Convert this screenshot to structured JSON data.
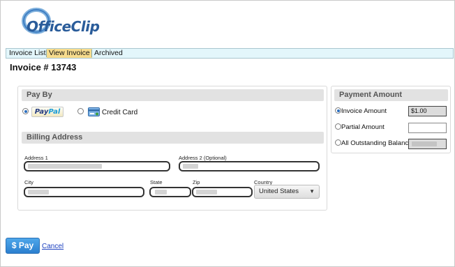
{
  "brand": {
    "logo_text": "OfficeClip",
    "logo_color": "#2a5c9a"
  },
  "tabs": [
    {
      "label": "Invoice List",
      "active": false
    },
    {
      "label": "View Invoice",
      "active": true
    },
    {
      "label": "Archived",
      "active": false
    }
  ],
  "page_title": "Invoice # 13743",
  "pay_by": {
    "heading": "Pay By",
    "options": [
      {
        "label": "PayPal",
        "selected": true,
        "icon": "paypal-logo"
      },
      {
        "label": "Credit Card",
        "selected": false,
        "icon": "credit-card-icon"
      }
    ]
  },
  "billing": {
    "heading": "Billing Address",
    "address1_label": "Address 1",
    "address2_label": "Address 2 (Optional)",
    "city_label": "City",
    "state_label": "State",
    "zip_label": "Zip",
    "country_label": "Country",
    "country_value": "United States"
  },
  "payment_amount": {
    "heading": "Payment Amount",
    "options": [
      {
        "label": "Invoice Amount",
        "selected": true,
        "value": "$1.00"
      },
      {
        "label": "Partial Amount",
        "selected": false,
        "value": ""
      },
      {
        "label": "All Outstanding Balance",
        "selected": false,
        "value": ""
      }
    ]
  },
  "actions": {
    "pay_label": "$ Pay",
    "cancel_label": "Cancel"
  },
  "colors": {
    "accent": "#2b7fcf",
    "tab_active": "#f7dc8d",
    "tabbar_bg": "#e3f6fb"
  }
}
